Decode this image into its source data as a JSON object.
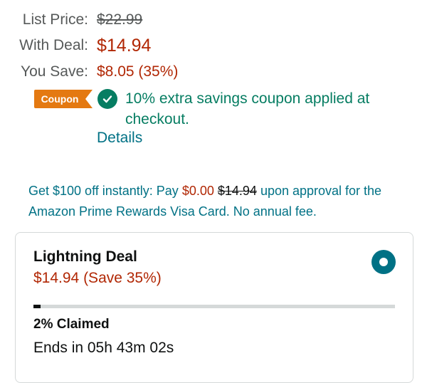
{
  "pricing": {
    "list_price_label": "List Price:",
    "list_price": "$22.99",
    "with_deal_label": "With Deal:",
    "with_deal_price": "$14.94",
    "you_save_label": "You Save:",
    "you_save_value": "$8.05 (35%)"
  },
  "coupon": {
    "badge": "Coupon",
    "text": "10% extra savings coupon applied at checkout.",
    "details_link": "Details"
  },
  "promo": {
    "part1": "Get $100 off instantly: Pay ",
    "price": "$0.00",
    "old_price": "$14.94",
    "part2": " upon approval for the Amazon Prime Rewards Visa Card. No annual fee."
  },
  "lightning_deal": {
    "title": "Lightning Deal",
    "price_line": "$14.94 (Save 35%)",
    "claimed_percent": 2,
    "claimed_text": "2% Claimed",
    "ends_text": "Ends in 05h 43m 02s"
  },
  "colors": {
    "price_red": "#b12704",
    "link_teal": "#007185",
    "success_green": "#067d62",
    "coupon_orange": "#e47911"
  }
}
